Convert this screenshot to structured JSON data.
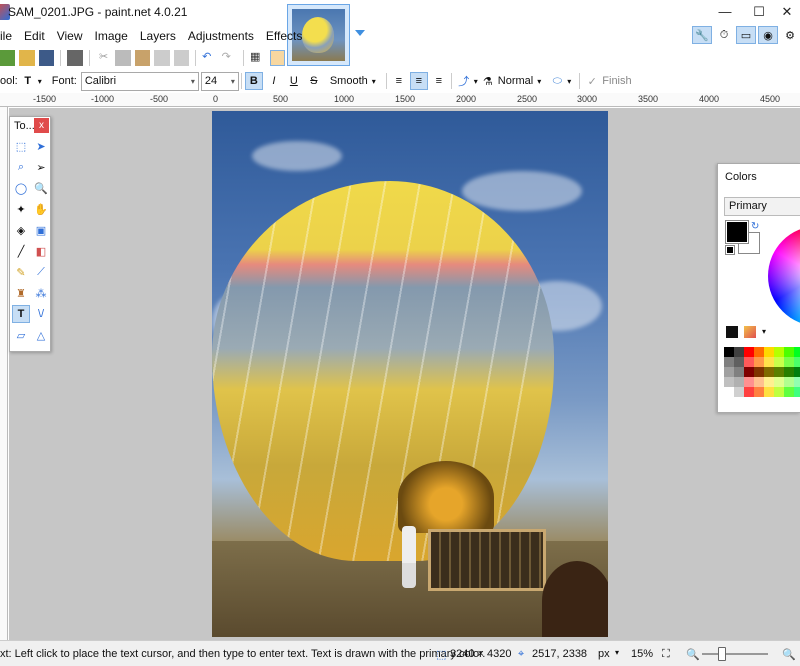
{
  "window": {
    "title": "SAM_0201.JPG - paint.net 4.0.21",
    "minimize": "—",
    "maximize": "☐",
    "close": "✕"
  },
  "menu": [
    "File",
    "Edit",
    "View",
    "Image",
    "Layers",
    "Adjustments",
    "Effects"
  ],
  "menu_visible": [
    "ile",
    "Edit",
    "View",
    "Image",
    "Layers",
    "Adjustments",
    "Effects"
  ],
  "toolbar2": {
    "tool_label": "ool:",
    "font_label": "Font:",
    "font_value": "Calibri",
    "size_value": "24",
    "bold": "B",
    "italic": "I",
    "underline": "U",
    "strike": "S",
    "antialias": "Smooth",
    "blend": "Normal",
    "finish": "Finish"
  },
  "ruler": [
    "-1500",
    "-1000",
    "-500",
    "0",
    "500",
    "1000",
    "1500",
    "2000",
    "2500",
    "3000",
    "3500",
    "4000",
    "4500"
  ],
  "tools": {
    "title": "To...",
    "close": "x"
  },
  "colors": {
    "title": "Colors",
    "mode": "Primary",
    "palette": [
      "#000000",
      "#404040",
      "#ff0000",
      "#ff6a00",
      "#ffd800",
      "#b6ff00",
      "#4cff00",
      "#00ff21",
      "#7f7f7f",
      "#606060",
      "#ff5a5a",
      "#ff9a4a",
      "#ffe34a",
      "#c9ff4a",
      "#7aff4a",
      "#4aff6a",
      "#a0a0a0",
      "#808080",
      "#7f0000",
      "#7f3300",
      "#7f6a00",
      "#5b7f00",
      "#267f00",
      "#007f0e",
      "#c0c0c0",
      "#b0b0b0",
      "#ff9090",
      "#ffc090",
      "#fff090",
      "#e0ff90",
      "#b0ff90",
      "#90ffb0",
      "#ffffff",
      "#d0d0d0",
      "#ff4040",
      "#ff8040",
      "#ffe040",
      "#c0ff40",
      "#60ff40",
      "#40ff80"
    ]
  },
  "status": {
    "hint": "xt: Left click to place the text cursor, and then type to enter text. Text is drawn with the primary color.",
    "image_size": "3240 × 4320",
    "cursor_pos": "2517, 2338",
    "units": "px",
    "zoom": "15%"
  }
}
